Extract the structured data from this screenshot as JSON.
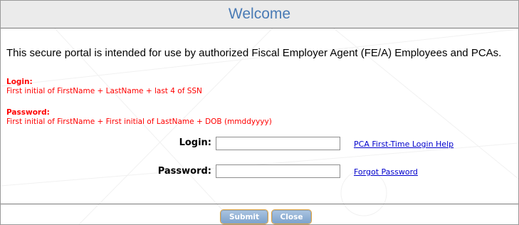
{
  "header": {
    "title": "Welcome"
  },
  "intro": {
    "text": "This secure portal is intended for use by authorized Fiscal Employer Agent (FE/A) Employees and PCAs."
  },
  "hints": {
    "login_title": "Login:",
    "login_text": "First initial of FirstName + LastName + last 4 of SSN",
    "password_title": "Password:",
    "password_text": "First initial of FirstName + First initial of LastName + DOB (mmddyyyy)"
  },
  "form": {
    "login_label": "Login:",
    "login_value": "",
    "password_label": "Password:",
    "password_value": ""
  },
  "links": {
    "pca_help": "PCA First-Time Login Help",
    "forgot_password": "Forgot Password"
  },
  "buttons": {
    "submit": "Submit",
    "close": "Close"
  },
  "colors": {
    "title": "#4a7bb5",
    "hint": "#ff0000",
    "link": "#0000cc",
    "button": "#7ea3cc",
    "button_outline": "#e2a23a"
  }
}
